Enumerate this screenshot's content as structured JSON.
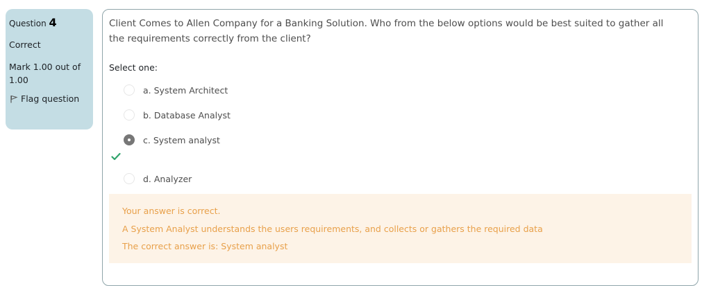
{
  "info": {
    "question_label": "Question",
    "question_number": "4",
    "state": "Correct",
    "grade": "Mark 1.00 out of 1.00",
    "flag_label": "Flag question"
  },
  "question": {
    "text": "Client Comes to Allen Company for a Banking Solution. Who from the below options would be best suited to gather all the requirements correctly from the client?",
    "prompt": "Select one:",
    "options": [
      {
        "label": "a. System Architect",
        "selected": false
      },
      {
        "label": "b. Database Analyst",
        "selected": false
      },
      {
        "label": "c. System analyst",
        "selected": true
      },
      {
        "label": "d. Analyzer",
        "selected": false
      }
    ]
  },
  "feedback": {
    "result": "Your answer is correct.",
    "explanation": "A System Analyst understands the users requirements, and collects or gathers the required data",
    "right_answer": "The correct answer is: System analyst"
  },
  "colors": {
    "info_bg": "#c4dde4",
    "feedback_bg": "#fdf3e7",
    "feedback_text": "#e8a04a",
    "correct_check": "#2fa36b"
  }
}
